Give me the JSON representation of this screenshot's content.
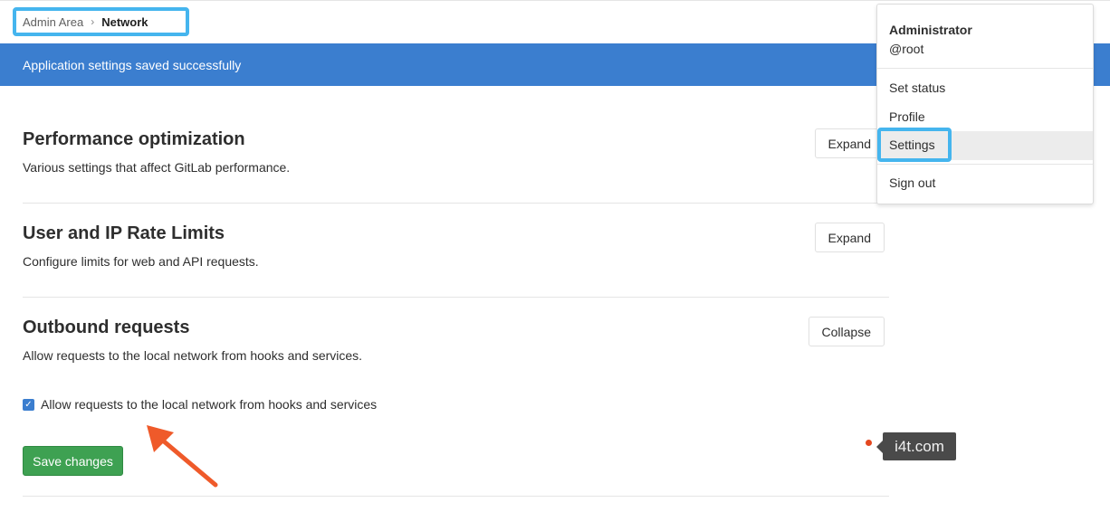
{
  "breadcrumb": {
    "parent": "Admin Area",
    "separator": "›",
    "current": "Network"
  },
  "flash": {
    "message": "Application settings saved successfully",
    "color": "#3b7ecf"
  },
  "sections": [
    {
      "title": "Performance optimization",
      "description": "Various settings that affect GitLab performance.",
      "button": "Expand"
    },
    {
      "title": "User and IP Rate Limits",
      "description": "Configure limits for web and API requests.",
      "button": "Expand"
    },
    {
      "title": "Outbound requests",
      "description": "Allow requests to the local network from hooks and services.",
      "button": "Collapse"
    }
  ],
  "outbound": {
    "checkbox_label": "Allow requests to the local network from hooks and services",
    "checkbox_checked": true,
    "save_label": "Save changes"
  },
  "user_menu": {
    "name": "Administrator",
    "username": "@root",
    "items": [
      "Set status",
      "Profile",
      "Settings",
      "Sign out"
    ],
    "highlighted": "Settings"
  },
  "watermark": {
    "text": "i4t.com"
  },
  "colors": {
    "highlight_box": "#45b5ee",
    "save_button": "#3ea152",
    "annotation_arrow": "#ef5a2a"
  }
}
